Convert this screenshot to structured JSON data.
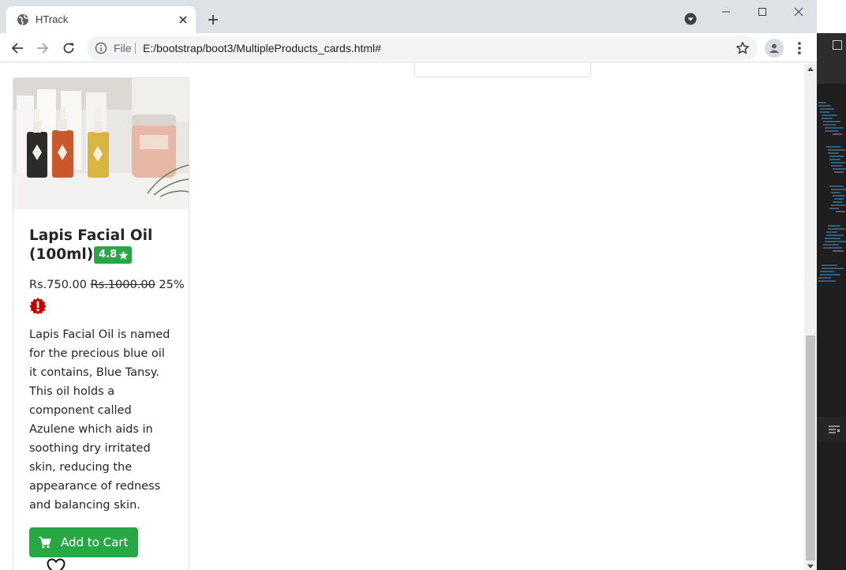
{
  "browser": {
    "tab_title": "HTrack",
    "url_scheme": "File",
    "url": "E:/bootstrap/boot3/MultipleProducts_cards.html#"
  },
  "product": {
    "name": "Lapis Facial Oil (100ml)",
    "rating": "4.8",
    "price": "Rs.750.00",
    "original_price": "Rs.1000.00",
    "discount": "25%",
    "description": "Lapis Facial Oil is named for the precious blue oil it contains, Blue Tansy. This oil holds a component called Azulene which aids in soothing dry irritated skin, reducing the appearance of redness and balancing skin.",
    "add_to_cart_label": "Add to Cart"
  },
  "colors": {
    "accent_green": "#28a745",
    "alert_red": "#c00000",
    "tabstrip": "#dee1e6"
  },
  "icons": [
    "globe-icon",
    "close-icon",
    "plus-icon",
    "back-icon",
    "forward-icon",
    "reload-icon",
    "info-icon",
    "bookmark-star-icon",
    "profile-icon",
    "menu-icon",
    "star-icon",
    "alert-icon",
    "cart-icon",
    "heart-icon"
  ]
}
